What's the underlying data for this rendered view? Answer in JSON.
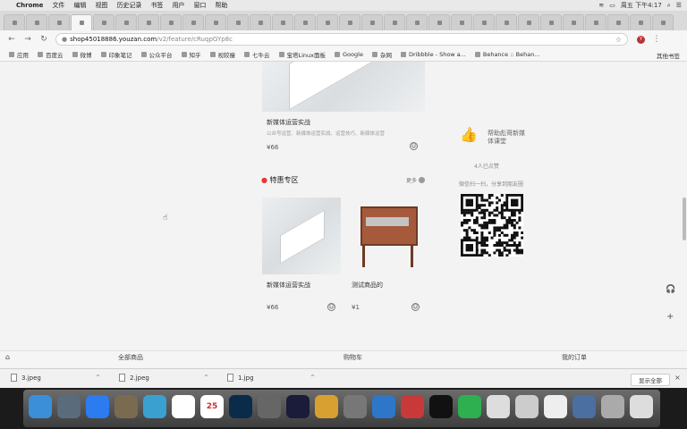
{
  "menubar": {
    "app": "Chrome",
    "items": [
      "文件",
      "编辑",
      "视图",
      "历史记录",
      "书签",
      "用户",
      "窗口",
      "帮助"
    ],
    "clock": "周五 下午4:17"
  },
  "address": {
    "url_host": "shop45018886.youzan.com",
    "url_path": "/v2/feature/cRuqpGYp8c"
  },
  "bookmarks": {
    "items": [
      "应用",
      "百度云",
      "微博",
      "印象笔记",
      "公众平台",
      "知乎",
      "视较瘦",
      "七牛云",
      "宝塔Linux面板",
      "Google",
      "杂网",
      "Dribbble - Show a...",
      "Behance :: Behan..."
    ],
    "other": "其他书签"
  },
  "page": {
    "top_product": {
      "name": "新媒体运营实战",
      "desc": "公众号运营、新媒体运营实战、运营技巧、新媒体运营",
      "price": "¥66"
    },
    "section_title": "特惠专区",
    "more_label": "更多",
    "products": [
      {
        "name": "新媒体运营实战",
        "price": "¥66"
      },
      {
        "name": "测试商品的",
        "price": "¥1"
      }
    ],
    "side": {
      "line1": "帮助彪哥新媒",
      "line2": "体课堂",
      "count": "4人已点赞",
      "scan_hint": "微信扫一扫，分享到朋友圈"
    },
    "bottom_nav": [
      "全部商品",
      "购物车",
      "我的订单"
    ]
  },
  "downloads": {
    "files": [
      "3.jpeg",
      "2.jpeg",
      "1.jpg"
    ],
    "show_all": "显示全部"
  },
  "dock": {
    "labels": [
      "25"
    ]
  },
  "colors": {
    "accent": "#e33333",
    "page_bg": "#f3f3f3"
  }
}
